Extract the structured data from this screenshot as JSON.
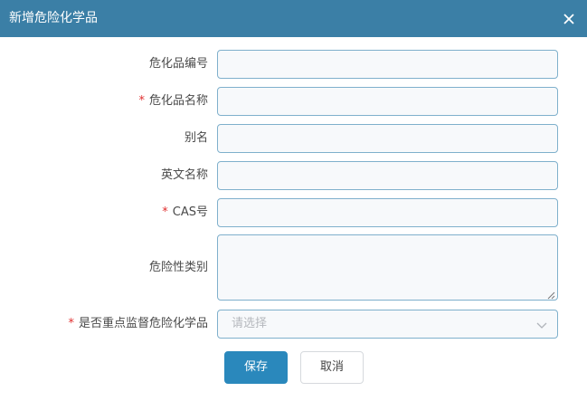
{
  "dialog": {
    "title": "新增危险化学品",
    "close_icon": "close-icon"
  },
  "form": {
    "fields": [
      {
        "label": "危化品编号",
        "required": false,
        "value": ""
      },
      {
        "label": "危化品名称",
        "required": true,
        "value": ""
      },
      {
        "label": "别名",
        "required": false,
        "value": ""
      },
      {
        "label": "英文名称",
        "required": false,
        "value": ""
      },
      {
        "label": "CAS号",
        "required": true,
        "value": ""
      },
      {
        "label": "危险性类别",
        "required": false,
        "value": ""
      },
      {
        "label": "是否重点监督危险化学品",
        "required": true,
        "placeholder": "请选择"
      }
    ],
    "required_mark": "*"
  },
  "buttons": {
    "save": "保存",
    "cancel": "取消"
  },
  "colors": {
    "header": "#3b7fa6",
    "primary": "#2a88bc",
    "required": "#e02f2f",
    "field_border": "#7fb0cc"
  }
}
